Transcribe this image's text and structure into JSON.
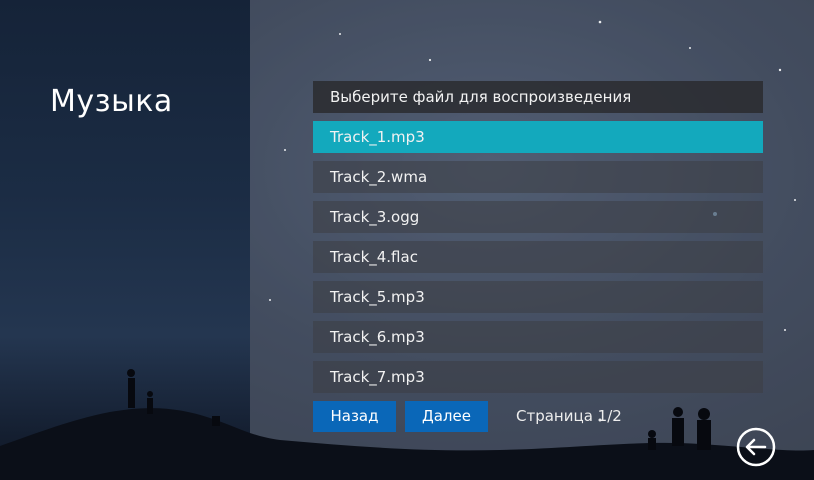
{
  "page": {
    "title": "Музыка"
  },
  "file_list": {
    "header": "Выберите файл для воспроизведения",
    "selected_index": 0,
    "items": [
      {
        "label": "Track_1.mp3"
      },
      {
        "label": "Track_2.wma"
      },
      {
        "label": "Track_3.ogg"
      },
      {
        "label": "Track_4.flac"
      },
      {
        "label": "Track_5.mp3"
      },
      {
        "label": "Track_6.mp3"
      },
      {
        "label": "Track_7.mp3"
      }
    ]
  },
  "pager": {
    "back_label": "Назад",
    "next_label": "Далее",
    "page_text": "Страница 1/2"
  },
  "icons": {
    "return": "return-arrow-icon"
  },
  "colors": {
    "selected_row": "#13a9bd",
    "button": "#0a67b8"
  }
}
